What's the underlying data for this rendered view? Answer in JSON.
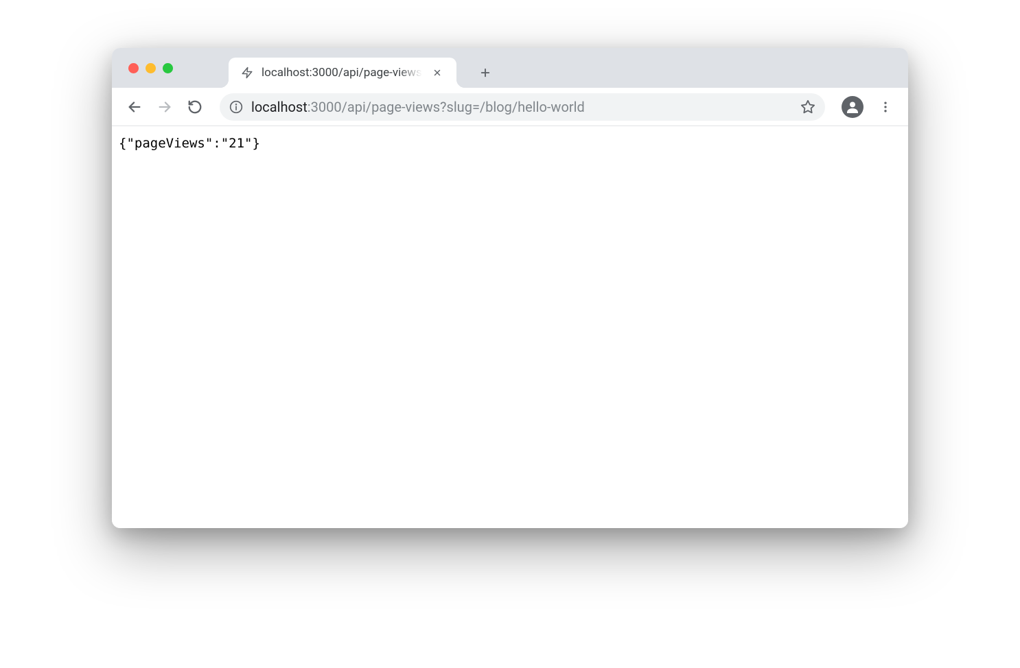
{
  "tab": {
    "title": "localhost:3000/api/page-views"
  },
  "address_bar": {
    "host": "localhost",
    "rest": ":3000/api/page-views?slug=/blog/hello-world"
  },
  "page_body": "{\"pageViews\":\"21\"}"
}
